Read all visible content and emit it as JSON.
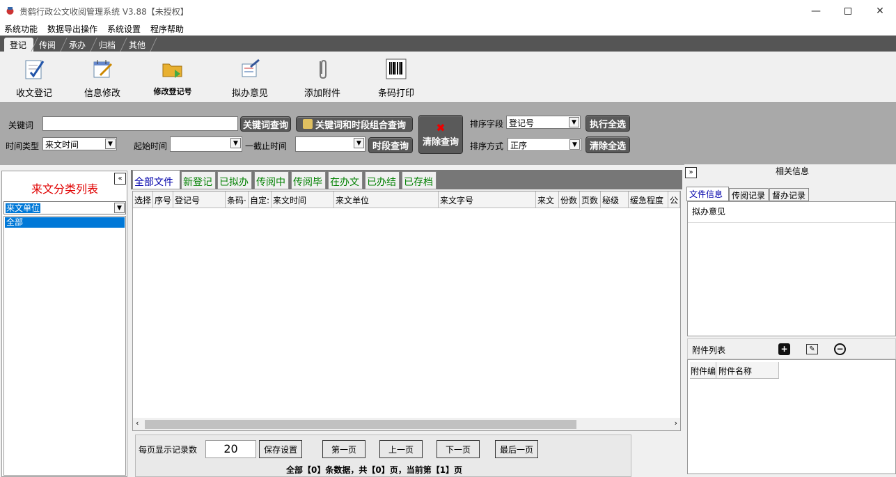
{
  "window": {
    "title": "贵鹤行政公文收阅管理系统 V3.88【未授权】"
  },
  "menu": [
    "系统功能",
    "数据导出操作",
    "系统设置",
    "程序帮助"
  ],
  "ribbon_tabs": [
    "登记",
    "传阅",
    "承办",
    "归档",
    "其他"
  ],
  "ribbon_buttons": [
    "收文登记",
    "信息修改",
    "修改登记号",
    "拟办意见",
    "添加附件",
    "条码打印"
  ],
  "search": {
    "keyword_label": "关键词",
    "keyword_btn": "关键词查询",
    "combo_btn": "关键词和时段组合查询",
    "clear_btn": "清除查询",
    "sort_field_label": "排序字段",
    "sort_field_value": "登记号",
    "exec_all_btn": "执行全选",
    "time_type_label": "时间类型",
    "time_type_value": "来文时间",
    "start_label": "起始时间",
    "end_label": "一截止时间",
    "period_btn": "时段查询",
    "sort_order_label": "排序方式",
    "sort_order_value": "正序",
    "clear_all_btn": "清除全选"
  },
  "left": {
    "title": "来文分类列表",
    "select_value": "来文单位",
    "list": [
      "全部"
    ]
  },
  "file_tabs": [
    "全部文件",
    "新登记",
    "已拟办",
    "传阅中",
    "传阅毕",
    "在办文",
    "已办结",
    "已存档"
  ],
  "grid_columns": [
    "选择",
    "序号",
    "登记号",
    "条码·",
    "自定:",
    "来文时间",
    "来文单位",
    "来文字号",
    "来文",
    "份数",
    "页数",
    "秘级",
    "缓急程度",
    "公"
  ],
  "pager": {
    "per_page_label": "每页显示记录数",
    "per_page_value": "20",
    "save_btn": "保存设置",
    "first_btn": "第一页",
    "prev_btn": "上一页",
    "next_btn": "下一页",
    "last_btn": "最后一页",
    "status": "全部【0】条数据，共【0】页，当前第【1】页"
  },
  "right": {
    "title": "相关信息",
    "tabs": [
      "文件信息",
      "传阅记录",
      "督办记录"
    ],
    "opinion_label": "拟办意见",
    "attach_label": "附件列表",
    "attach_columns": [
      "附件编",
      "附件名称"
    ]
  }
}
